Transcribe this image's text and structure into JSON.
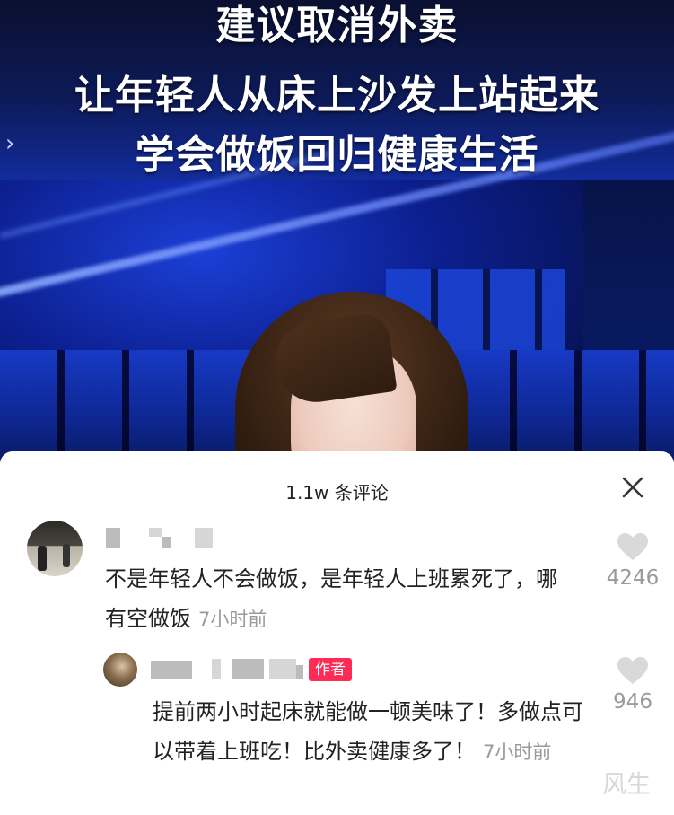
{
  "video": {
    "headline_lines": [
      "建议取消外卖",
      "让年轻人从床上沙发上站起来",
      "学会做饭回归健康生活"
    ],
    "nav_chevron": "›",
    "accent_color": "#1b3fd6"
  },
  "comments_sheet": {
    "title": "1.1w 条评论",
    "close_icon": "close-icon",
    "comments": [
      {
        "text": "不是年轻人不会做饭，是年轻人上班累死了，哪有空做饭",
        "time": "7小时前",
        "likes": "4246"
      }
    ],
    "reply": {
      "author_tag": "作者",
      "text": "提前两小时起床就能做一顿美味了！多做点可以带着上班吃！比外卖健康多了！",
      "time": "7小时前",
      "likes": "946"
    },
    "tag_color": "#fe2c55"
  },
  "watermark": "风生"
}
